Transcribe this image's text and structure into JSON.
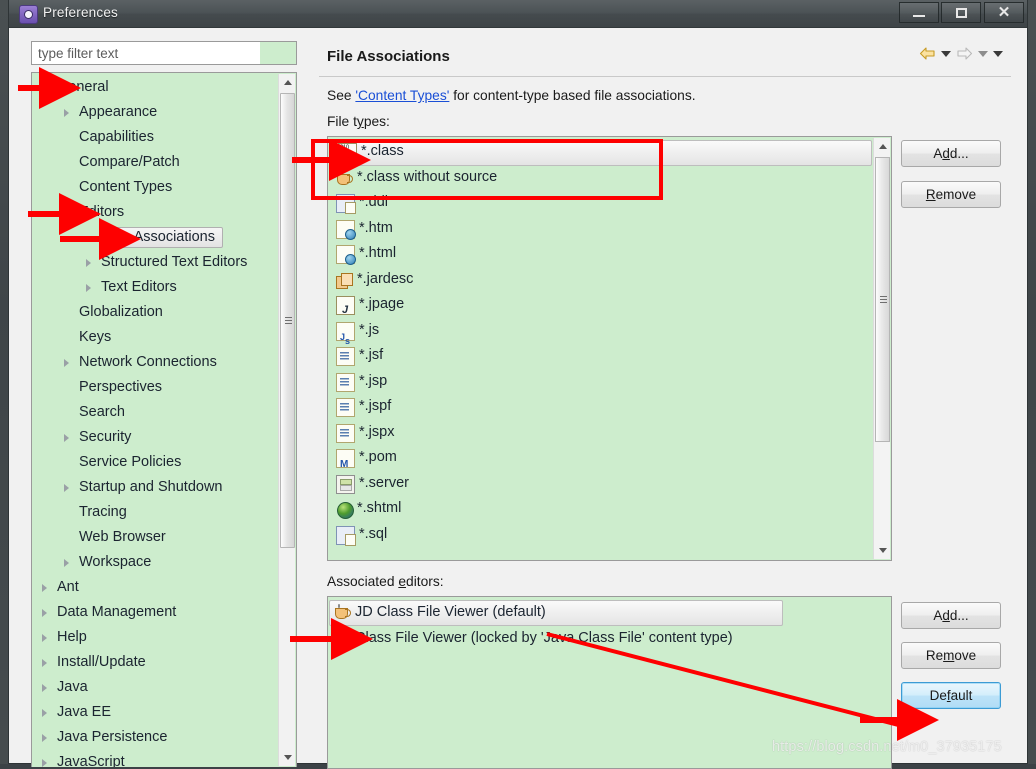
{
  "window": {
    "title": "Preferences",
    "icon": "preferences-gear-icon",
    "buttons": {
      "minimize": "minimize-icon",
      "maximize": "maximize-icon",
      "close": "close-icon"
    }
  },
  "filter": {
    "placeholder": "type filter text",
    "value": ""
  },
  "tree": {
    "items": [
      {
        "label": "General",
        "indent": 0,
        "state": "expanded"
      },
      {
        "label": "Appearance",
        "indent": 1,
        "state": "collapsed"
      },
      {
        "label": "Capabilities",
        "indent": 1,
        "state": "leaf"
      },
      {
        "label": "Compare/Patch",
        "indent": 1,
        "state": "leaf"
      },
      {
        "label": "Content Types",
        "indent": 1,
        "state": "leaf"
      },
      {
        "label": "Editors",
        "indent": 1,
        "state": "expanded"
      },
      {
        "label": "File Associations",
        "indent": 2,
        "state": "leaf",
        "selected": true
      },
      {
        "label": "Structured Text Editors",
        "indent": 2,
        "state": "collapsed"
      },
      {
        "label": "Text Editors",
        "indent": 2,
        "state": "collapsed"
      },
      {
        "label": "Globalization",
        "indent": 1,
        "state": "leaf"
      },
      {
        "label": "Keys",
        "indent": 1,
        "state": "leaf"
      },
      {
        "label": "Network Connections",
        "indent": 1,
        "state": "collapsed"
      },
      {
        "label": "Perspectives",
        "indent": 1,
        "state": "leaf"
      },
      {
        "label": "Search",
        "indent": 1,
        "state": "leaf"
      },
      {
        "label": "Security",
        "indent": 1,
        "state": "collapsed"
      },
      {
        "label": "Service Policies",
        "indent": 1,
        "state": "leaf"
      },
      {
        "label": "Startup and Shutdown",
        "indent": 1,
        "state": "collapsed"
      },
      {
        "label": "Tracing",
        "indent": 1,
        "state": "leaf"
      },
      {
        "label": "Web Browser",
        "indent": 1,
        "state": "leaf"
      },
      {
        "label": "Workspace",
        "indent": 1,
        "state": "collapsed"
      },
      {
        "label": "Ant",
        "indent": 0,
        "state": "collapsed"
      },
      {
        "label": "Data Management",
        "indent": 0,
        "state": "collapsed"
      },
      {
        "label": "Help",
        "indent": 0,
        "state": "collapsed"
      },
      {
        "label": "Install/Update",
        "indent": 0,
        "state": "collapsed"
      },
      {
        "label": "Java",
        "indent": 0,
        "state": "collapsed"
      },
      {
        "label": "Java EE",
        "indent": 0,
        "state": "collapsed"
      },
      {
        "label": "Java Persistence",
        "indent": 0,
        "state": "collapsed"
      },
      {
        "label": "JavaScript",
        "indent": 0,
        "state": "collapsed"
      }
    ]
  },
  "page": {
    "title": "File Associations",
    "nav": {
      "back_icon": "back-arrow-icon",
      "back_menu_icon": "chevron-down-icon",
      "forward_icon": "forward-arrow-icon",
      "forward_menu_icon": "chevron-down-icon",
      "more_icon": "chevron-down-icon"
    },
    "see_prefix": "See ",
    "see_link": "'Content Types'",
    "see_suffix": " for content-type based file associations.",
    "file_types_label_pre": "File t",
    "file_types_label_mnemonic": "y",
    "file_types_label_post": "pes:",
    "assoc_label_pre": "Associated ",
    "assoc_label_mnemonic": "e",
    "assoc_label_post": "ditors:"
  },
  "file_types": [
    {
      "name": "*.class",
      "icon": "java-class-file-icon",
      "selected": true
    },
    {
      "name": "*.class without source",
      "icon": "coffee-cup-icon"
    },
    {
      "name": "*.ddl",
      "icon": "sql-document-icon"
    },
    {
      "name": "*.htm",
      "icon": "web-page-icon"
    },
    {
      "name": "*.html",
      "icon": "web-page-icon"
    },
    {
      "name": "*.jardesc",
      "icon": "jar-description-icon"
    },
    {
      "name": "*.jpage",
      "icon": "java-scrapbook-page-icon"
    },
    {
      "name": "*.js",
      "icon": "javascript-file-icon"
    },
    {
      "name": "*.jsf",
      "icon": "jsp-document-icon"
    },
    {
      "name": "*.jsp",
      "icon": "jsp-document-icon"
    },
    {
      "name": "*.jspf",
      "icon": "jsp-document-icon"
    },
    {
      "name": "*.jspx",
      "icon": "jsp-document-icon"
    },
    {
      "name": "*.pom",
      "icon": "maven-pom-icon"
    },
    {
      "name": "*.server",
      "icon": "server-file-icon"
    },
    {
      "name": "*.shtml",
      "icon": "globe-icon"
    },
    {
      "name": "*.sql",
      "icon": "sql-document-icon"
    }
  ],
  "associated_editors": [
    {
      "name": "JD Class File Viewer (default)",
      "icon": "coffee-cup-icon",
      "selected": true
    },
    {
      "name": "Class File Viewer (locked by 'Java Class File' content type)",
      "icon": "java-class-file-icon"
    }
  ],
  "buttons": {
    "file_types_add": {
      "pre": "A",
      "mnemonic": "d",
      "post": "d..."
    },
    "file_types_remove": {
      "pre": "",
      "mnemonic": "R",
      "post": "emove"
    },
    "assoc_add": {
      "pre": "A",
      "mnemonic": "d",
      "post": "d..."
    },
    "assoc_remove": {
      "pre": "Re",
      "mnemonic": "m",
      "post": "ove"
    },
    "assoc_default": {
      "pre": "De",
      "mnemonic": "f",
      "post": "ault"
    }
  },
  "annotations": {
    "color": "#fe0000",
    "box_around": [
      "*.class",
      "*.class without source"
    ],
    "arrows": [
      "points-to-general",
      "points-to-editors",
      "points-to-file-associations",
      "points-to-class-file-type",
      "points-to-jd-class-file-viewer",
      "points-to-default-button"
    ],
    "line_from_jd_viewer_to_default_button": true
  },
  "watermark": {
    "text": "https://blog.csdn.net/m0_37935175"
  }
}
